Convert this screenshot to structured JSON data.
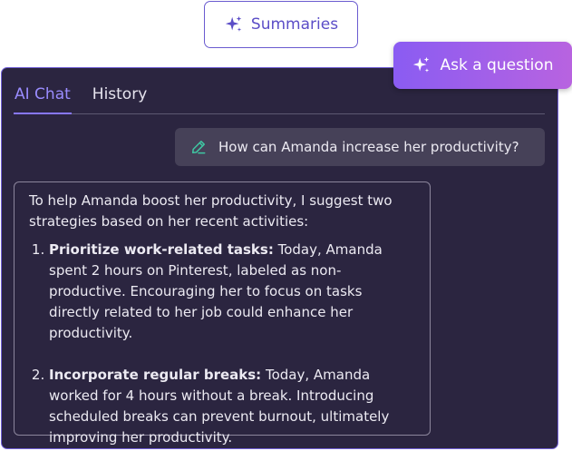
{
  "summaries_button": {
    "label": "Summaries",
    "icon": "sparkles-icon"
  },
  "ask_button": {
    "label": "Ask a question",
    "icon": "sparkles-icon"
  },
  "tabs": [
    {
      "label": "AI Chat",
      "active": true
    },
    {
      "label": "History",
      "active": false
    }
  ],
  "question": {
    "icon": "pen-icon",
    "text": "How can Amanda increase her productivity?"
  },
  "answer": {
    "intro": "To help Amanda boost her productivity, I suggest two strategies based on her recent activities:",
    "items": [
      {
        "title": "Prioritize work-related tasks:",
        "body": " Today, Amanda spent 2 hours on Pinterest, labeled as non-productive. Encouraging her to focus on tasks directly related to her job could enhance her productivity."
      },
      {
        "title": "Incorporate regular breaks:",
        "body": " Today, Amanda worked for 4 hours without a break. Introducing scheduled breaks can prevent burnout, ultimately improving her productivity."
      }
    ]
  },
  "colors": {
    "panel_bg": "#2b2540",
    "accent": "#8777ff",
    "ask_gradient_start": "#8a5cf2",
    "ask_gradient_end": "#b863e0",
    "pen_icon": "#3fc6a2"
  }
}
